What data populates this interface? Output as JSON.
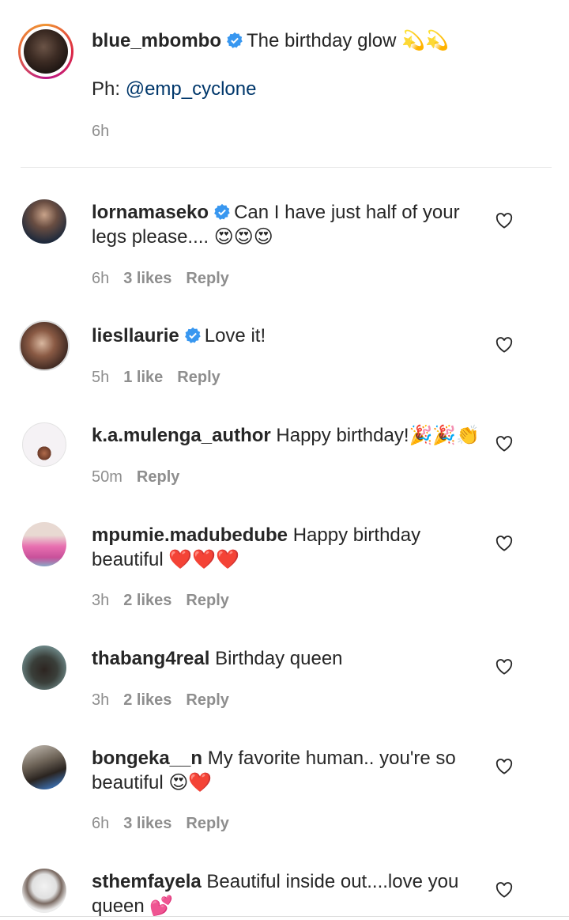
{
  "caption": {
    "username": "blue_mbombo",
    "text": "The birthday glow 💫💫",
    "credit_prefix": "Ph: ",
    "credit_handle": "@emp_cyclone",
    "time": "6h"
  },
  "comments": [
    {
      "username": "lornamaseko",
      "verified": true,
      "line1": "Can I have just half of your",
      "line2": "legs please.... 😍😍😍",
      "time": "6h",
      "likes": "3 likes",
      "reply": "Reply"
    },
    {
      "username": "liesllaurie",
      "verified": true,
      "line1": "Love it!",
      "line2": "",
      "time": "5h",
      "likes": "1 like",
      "reply": "Reply"
    },
    {
      "username": "k.a.mulenga_author",
      "verified": false,
      "line1": "Happy birthday!🎉🎉👏",
      "line2": "",
      "time": "50m",
      "likes": "",
      "reply": "Reply"
    },
    {
      "username": "mpumie.madubedube",
      "verified": false,
      "line1": "Happy birthday",
      "line2": "beautiful ❤️❤️❤️",
      "time": "3h",
      "likes": "2 likes",
      "reply": "Reply"
    },
    {
      "username": "thabang4real",
      "verified": false,
      "line1": "Birthday queen",
      "line2": "",
      "time": "3h",
      "likes": "2 likes",
      "reply": "Reply"
    },
    {
      "username": "bongeka__n",
      "verified": false,
      "line1": "My favorite human.. you're so",
      "line2": "beautiful 😍❤️",
      "time": "6h",
      "likes": "3 likes",
      "reply": "Reply"
    },
    {
      "username": "sthemfayela",
      "verified": false,
      "line1": "Beautiful inside out....love you",
      "line2": "queen 💕",
      "time": "",
      "likes": "",
      "reply": ""
    }
  ],
  "icons": {
    "like": "heart-outline-icon",
    "verified": "verified-badge-icon"
  },
  "colors": {
    "verified": "#3897f0",
    "link": "#00376b",
    "meta": "#8e8e8e"
  }
}
